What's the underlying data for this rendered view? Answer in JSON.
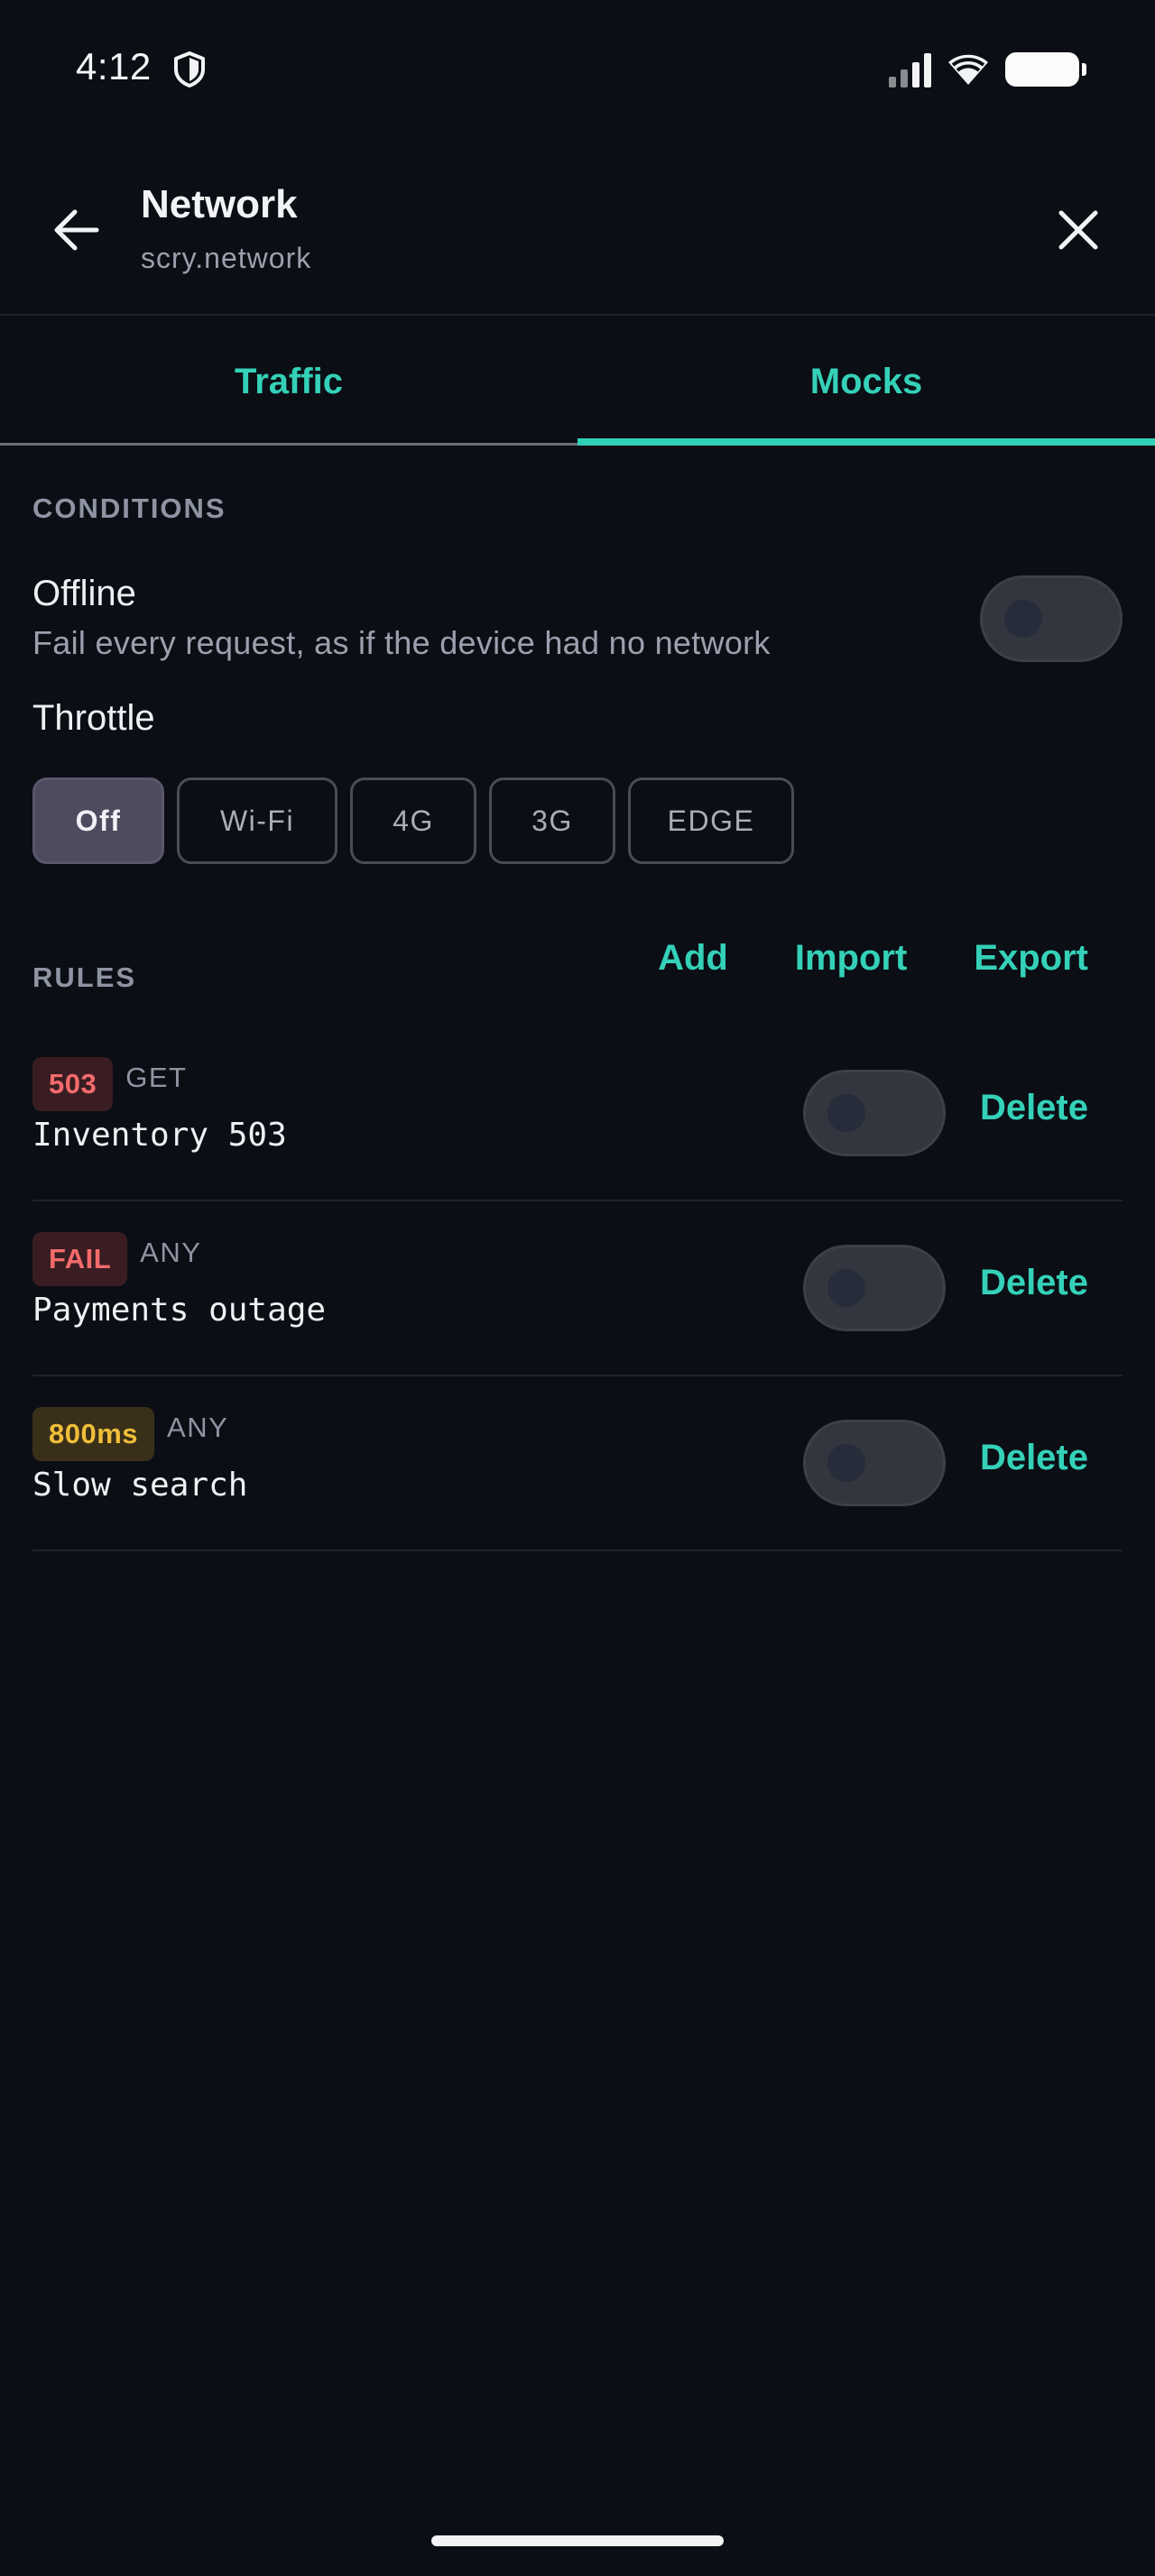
{
  "status_bar": {
    "time": "4:12",
    "icons": [
      "shield-icon",
      "cell-signal-icon",
      "wifi-icon",
      "battery-icon"
    ]
  },
  "header": {
    "title": "Network",
    "subtitle": "scry.network",
    "back_icon": "arrow-left-icon",
    "close_icon": "close-icon"
  },
  "tabs": [
    {
      "label": "Traffic",
      "active": false
    },
    {
      "label": "Mocks",
      "active": true
    }
  ],
  "conditions": {
    "section_label": "CONDITIONS",
    "offline": {
      "title": "Offline",
      "description": "Fail every request, as if the device had no network",
      "enabled": false
    },
    "throttle": {
      "title": "Throttle",
      "options": [
        "Off",
        "Wi-Fi",
        "4G",
        "3G",
        "EDGE"
      ],
      "selected": "Off"
    }
  },
  "rules": {
    "section_label": "RULES",
    "actions": {
      "add": "Add",
      "import": "Import",
      "export": "Export"
    },
    "delete_label": "Delete",
    "items": [
      {
        "badge": "503",
        "badge_color": "#f46b6b",
        "method": "GET",
        "name": "Inventory 503",
        "enabled": false
      },
      {
        "badge": "FAIL",
        "badge_color": "#f46b6b",
        "method": "ANY",
        "name": "Payments outage",
        "enabled": false
      },
      {
        "badge": "800ms",
        "badge_color": "#f1be3a",
        "method": "ANY",
        "name": "Slow search",
        "enabled": false
      }
    ]
  },
  "colors": {
    "background": "#0b0e15",
    "accent": "#2fd0b5",
    "muted_text": "#9aa0ad",
    "error": "#f46b6b",
    "warning": "#f1be3a"
  }
}
